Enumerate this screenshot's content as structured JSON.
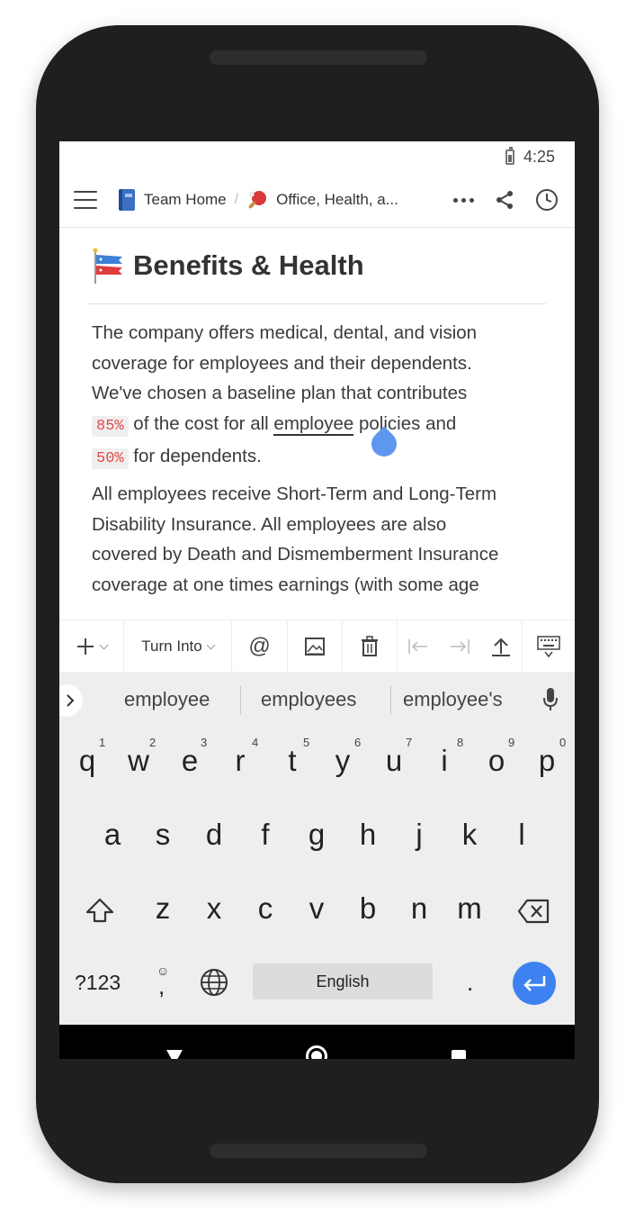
{
  "status_bar": {
    "time": "4:25"
  },
  "navbar": {
    "breadcrumb_1": "Team Home",
    "breadcrumb_separator": "/",
    "breadcrumb_2": "Office, Health, a..."
  },
  "document": {
    "title": "Benefits & Health",
    "para1": {
      "line1": "The company offers medical, dental, and vision",
      "line2": "coverage for employees and their dependents.",
      "line3": "We've chosen a baseline plan that contributes",
      "code1": "85%",
      "mid1": " of the cost for all ",
      "underlined": "employee",
      "mid2": " policies and",
      "code2": "50%",
      "end": " for dependents."
    },
    "para2": {
      "line1": "All employees receive Short-Term and Long-Term",
      "line2": "Disability Insurance. All employees are also",
      "line3": "covered by Death and Dismemberment Insurance",
      "line4": "coverage at one times earnings (with some age"
    }
  },
  "toolbar": {
    "turn_into": "Turn Into"
  },
  "keyboard": {
    "suggestions": [
      "employee",
      "employees",
      "employee's"
    ],
    "row1": [
      "q",
      "w",
      "e",
      "r",
      "t",
      "y",
      "u",
      "i",
      "o",
      "p"
    ],
    "row1_hints": [
      "1",
      "2",
      "3",
      "4",
      "5",
      "6",
      "7",
      "8",
      "9",
      "0"
    ],
    "row2": [
      "a",
      "s",
      "d",
      "f",
      "g",
      "h",
      "j",
      "k",
      "l"
    ],
    "row3": [
      "z",
      "x",
      "c",
      "v",
      "b",
      "n",
      "m"
    ],
    "symbols_key": "?123",
    "comma_key": ",",
    "space_label": "English",
    "period_key": "."
  },
  "colors": {
    "accent_blue": "#3d82f0",
    "code_red": "#e04a4a",
    "phone_body": "#1f1f1f"
  }
}
